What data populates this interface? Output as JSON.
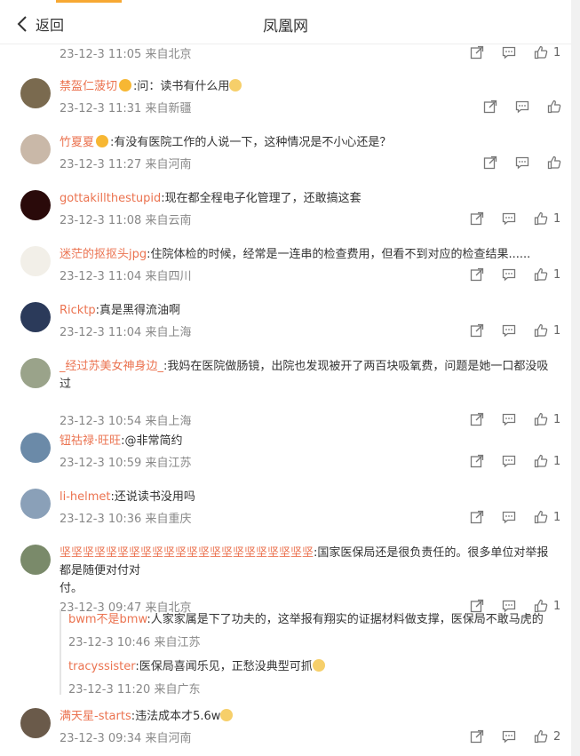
{
  "header": {
    "back_label": "返回",
    "title": "凤凰网"
  },
  "top_partial": {
    "meta": "23-12-3 11:05 来自北京",
    "likes": "1"
  },
  "comments": [
    {
      "username": "禁盔仁菠切",
      "crown": true,
      "text": ":问：读书有什么用",
      "emoji": true,
      "meta": "23-12-3 11:31 来自新疆",
      "likes": ""
    },
    {
      "username": "竹夏夏",
      "crown": true,
      "text": ":有没有医院工作的人说一下，这种情况是不小心还是？",
      "emoji": false,
      "meta": "23-12-3 11:27 来自河南",
      "likes": ""
    },
    {
      "username": "gottakillthestupid",
      "crown": false,
      "text": ":现在都全程电子化管理了，还敢搞这套",
      "emoji": false,
      "meta": "23-12-3 11:08 来自云南",
      "likes": "1"
    },
    {
      "username": "迷茫的抠抠头jpg",
      "crown": false,
      "text": ":住院体检的时候，经常是一连串的检查费用，但看不到对应的检查结果......",
      "emoji": false,
      "meta": "23-12-3 11:04 来自四川",
      "likes": "1"
    },
    {
      "username": "Ricktp",
      "crown": false,
      "text": ":真是黑得流油啊",
      "emoji": false,
      "meta": "23-12-3 11:04 来自上海",
      "likes": "1"
    },
    {
      "username": "_经过苏美女神身边_",
      "crown": false,
      "text": ":我妈在医院做肠镜，出院也发现被开了两百块吸氧费，问题是她一口都没吸",
      "text2": "过",
      "emoji": false,
      "meta": "23-12-3 10:54 来自上海",
      "likes": "1"
    },
    {
      "username": "钮祜禄·旺旺",
      "crown": false,
      "text": ":@非常简约",
      "emoji": false,
      "meta": "23-12-3 10:59 来自江苏",
      "likes": "1"
    },
    {
      "username": "li-helmet",
      "crown": false,
      "text": ":还说读书没用吗",
      "emoji": false,
      "meta": "23-12-3 10:36 来自重庆",
      "likes": "1"
    },
    {
      "username": "坚坚坚坚坚坚坚坚坚坚坚坚坚坚坚坚坚坚坚坚坚坚",
      "crown": false,
      "text": ":国家医保局还是很负责任的。很多单位对举报都是随便对付对",
      "text2": "付。",
      "emoji": false,
      "meta": "23-12-3 09:47 来自北京",
      "likes": "1"
    },
    {
      "username": "满天星-starts",
      "crown": false,
      "text": ":违法成本才5.6w",
      "emoji": true,
      "meta": "23-12-3 09:34 来自河南",
      "likes": "2"
    }
  ],
  "replies": [
    {
      "username": "bwm不是bmw",
      "text": ":人家家属是下了功夫的，这举报有翔实的证据材料做支撑，医保局不敢马虎的",
      "meta": "23-12-3 10:46 来自江苏"
    },
    {
      "username": "tracyssister",
      "text": ":医保局喜闻乐见，正愁没典型可抓",
      "meta": "23-12-3 11:20 来自广东"
    }
  ]
}
